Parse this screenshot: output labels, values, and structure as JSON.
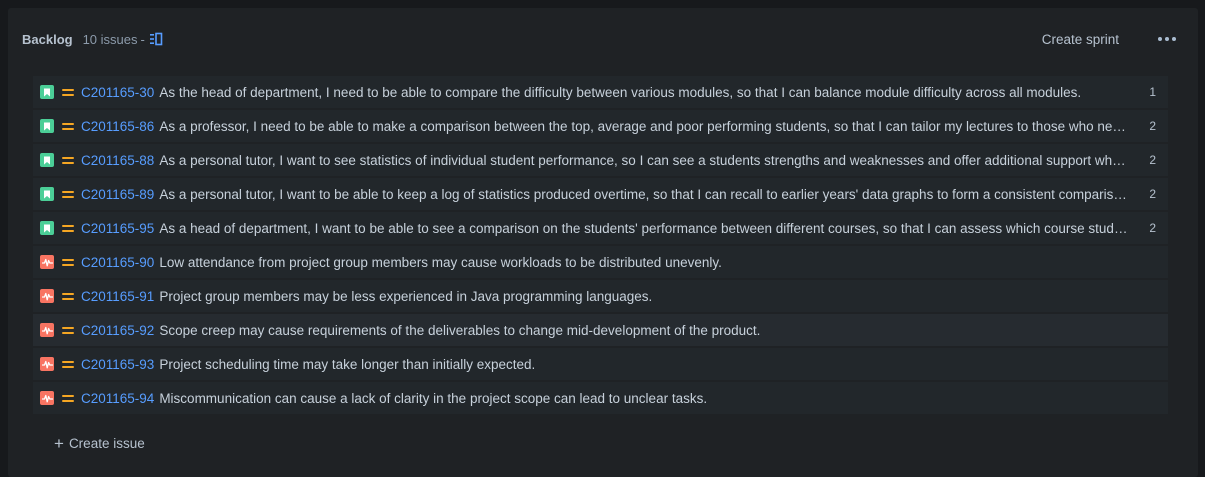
{
  "backlog": {
    "title": "Backlog",
    "issue_count": "10 issues",
    "separator": "-",
    "create_sprint_label": "Create sprint",
    "more_icon": "ellipsis-icon",
    "create_issue_label": "Create issue"
  },
  "colors": {
    "story": "#4bce97",
    "risk": "#f87462",
    "priority_medium": "#f5a623",
    "link": "#579dff"
  },
  "issues": [
    {
      "type": "story",
      "key": "C201165-30",
      "summary": "As the head of department, I need to be able to compare the difficulty between various modules, so that I can balance module difficulty across all modules.",
      "points": "1"
    },
    {
      "type": "story",
      "key": "C201165-86",
      "summary": "As a professor, I need to be able to make a comparison between the top, average and poor performing students, so that I can tailor my lectures to those who need additional support.",
      "points": "2"
    },
    {
      "type": "story",
      "key": "C201165-88",
      "summary": "As a personal tutor, I want to see statistics of individual student performance, so I can see a students strengths and weaknesses and offer additional support where needed.",
      "points": "2"
    },
    {
      "type": "story",
      "key": "C201165-89",
      "summary": "As a personal tutor, I want to be able to keep a log of statistics produced overtime, so that I can recall to earlier years' data graphs to form a consistent comparison.",
      "points": "2"
    },
    {
      "type": "story",
      "key": "C201165-95",
      "summary": "As a head of department, I want to be able to see a comparison on the students' performance between different courses, so that I can assess which course students perform better in.",
      "points": "2"
    },
    {
      "type": "risk",
      "key": "C201165-90",
      "summary": "Low attendance from project group members may cause workloads to be distributed unevenly.",
      "points": ""
    },
    {
      "type": "risk",
      "key": "C201165-91",
      "summary": "Project group members may be less experienced in Java programming languages.",
      "points": ""
    },
    {
      "type": "risk",
      "key": "C201165-92",
      "summary": "Scope creep may cause requirements of the deliverables to change mid-development of the product.",
      "points": ""
    },
    {
      "type": "risk",
      "key": "C201165-93",
      "summary": "Project scheduling time may take longer than initially expected.",
      "points": ""
    },
    {
      "type": "risk",
      "key": "C201165-94",
      "summary": "Miscommunication can cause a lack of clarity in the project scope can lead to unclear tasks.",
      "points": ""
    }
  ]
}
